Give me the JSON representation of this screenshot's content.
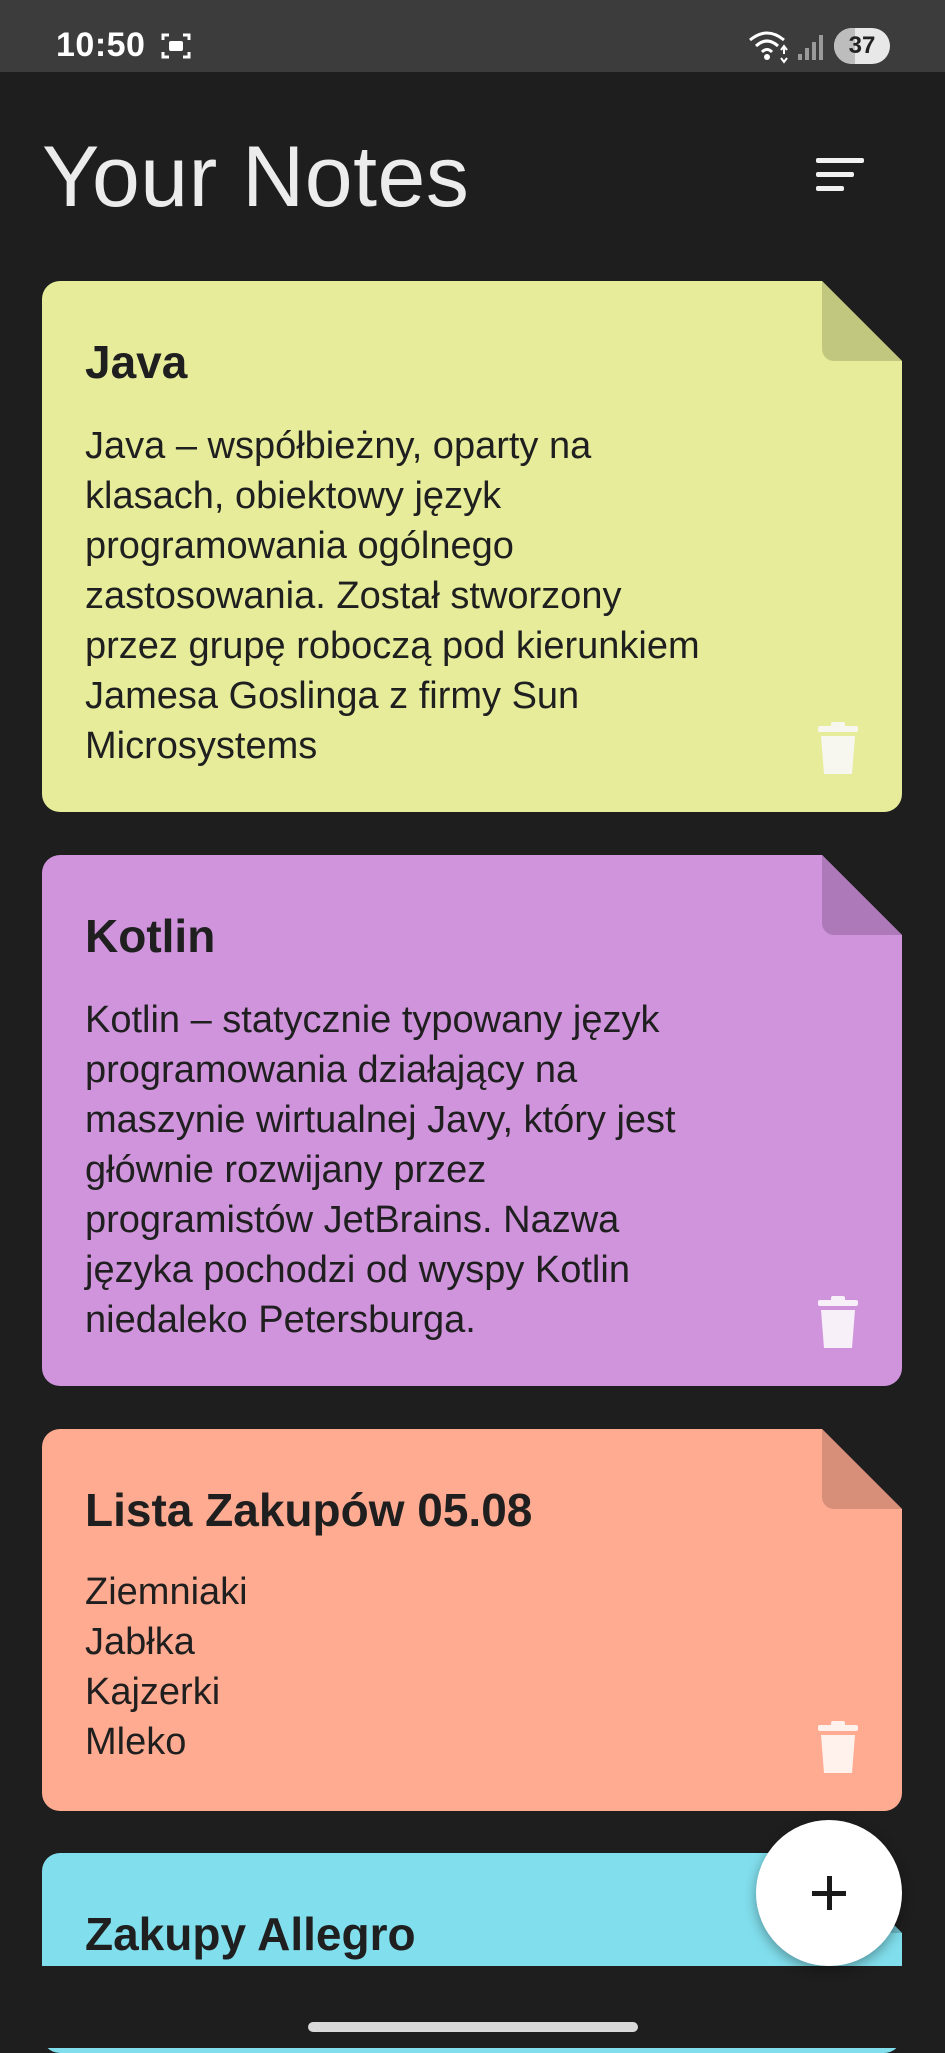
{
  "status_bar": {
    "time": "10:50",
    "battery": "37",
    "battery_level": 0.37,
    "icons": [
      "screenshot-icon",
      "wifi-icon",
      "signal-icon",
      "battery-icon"
    ]
  },
  "header": {
    "title": "Your Notes",
    "sort_icon": "sort-icon"
  },
  "notes": [
    {
      "title": "Java",
      "body": "Java – współbieżny, oparty na\nklasach, obiektowy język\nprogramowania ogólnego\nzastosowania. Został stworzony\nprzez grupę roboczą pod kierunkiem\nJamesa Goslinga z firmy Sun\nMicrosystems",
      "color": "#e6ec9a",
      "fold_color": "#c2c77f"
    },
    {
      "title": "Kotlin",
      "body": "Kotlin – statycznie typowany język\nprogramowania działający na\nmaszynie wirtualnej Javy, który jest\ngłównie rozwijany przez\nprogramistów JetBrains. Nazwa\njęzyka pochodzi od wyspy Kotlin\nniedaleko Petersburga.",
      "color": "#cf94dc",
      "fold_color": "#ad79b9"
    },
    {
      "title": "Lista Zakupów 05.08",
      "body": "Ziemniaki\nJabłka\nKajzerki\nMleko",
      "color": "#ffab91",
      "fold_color": "#d88f7a"
    },
    {
      "title": "Zakupy Allegro",
      "body": "",
      "color": "#81deec",
      "fold_color": "#6bbac7"
    }
  ],
  "fab": {
    "icon": "plus-icon"
  }
}
